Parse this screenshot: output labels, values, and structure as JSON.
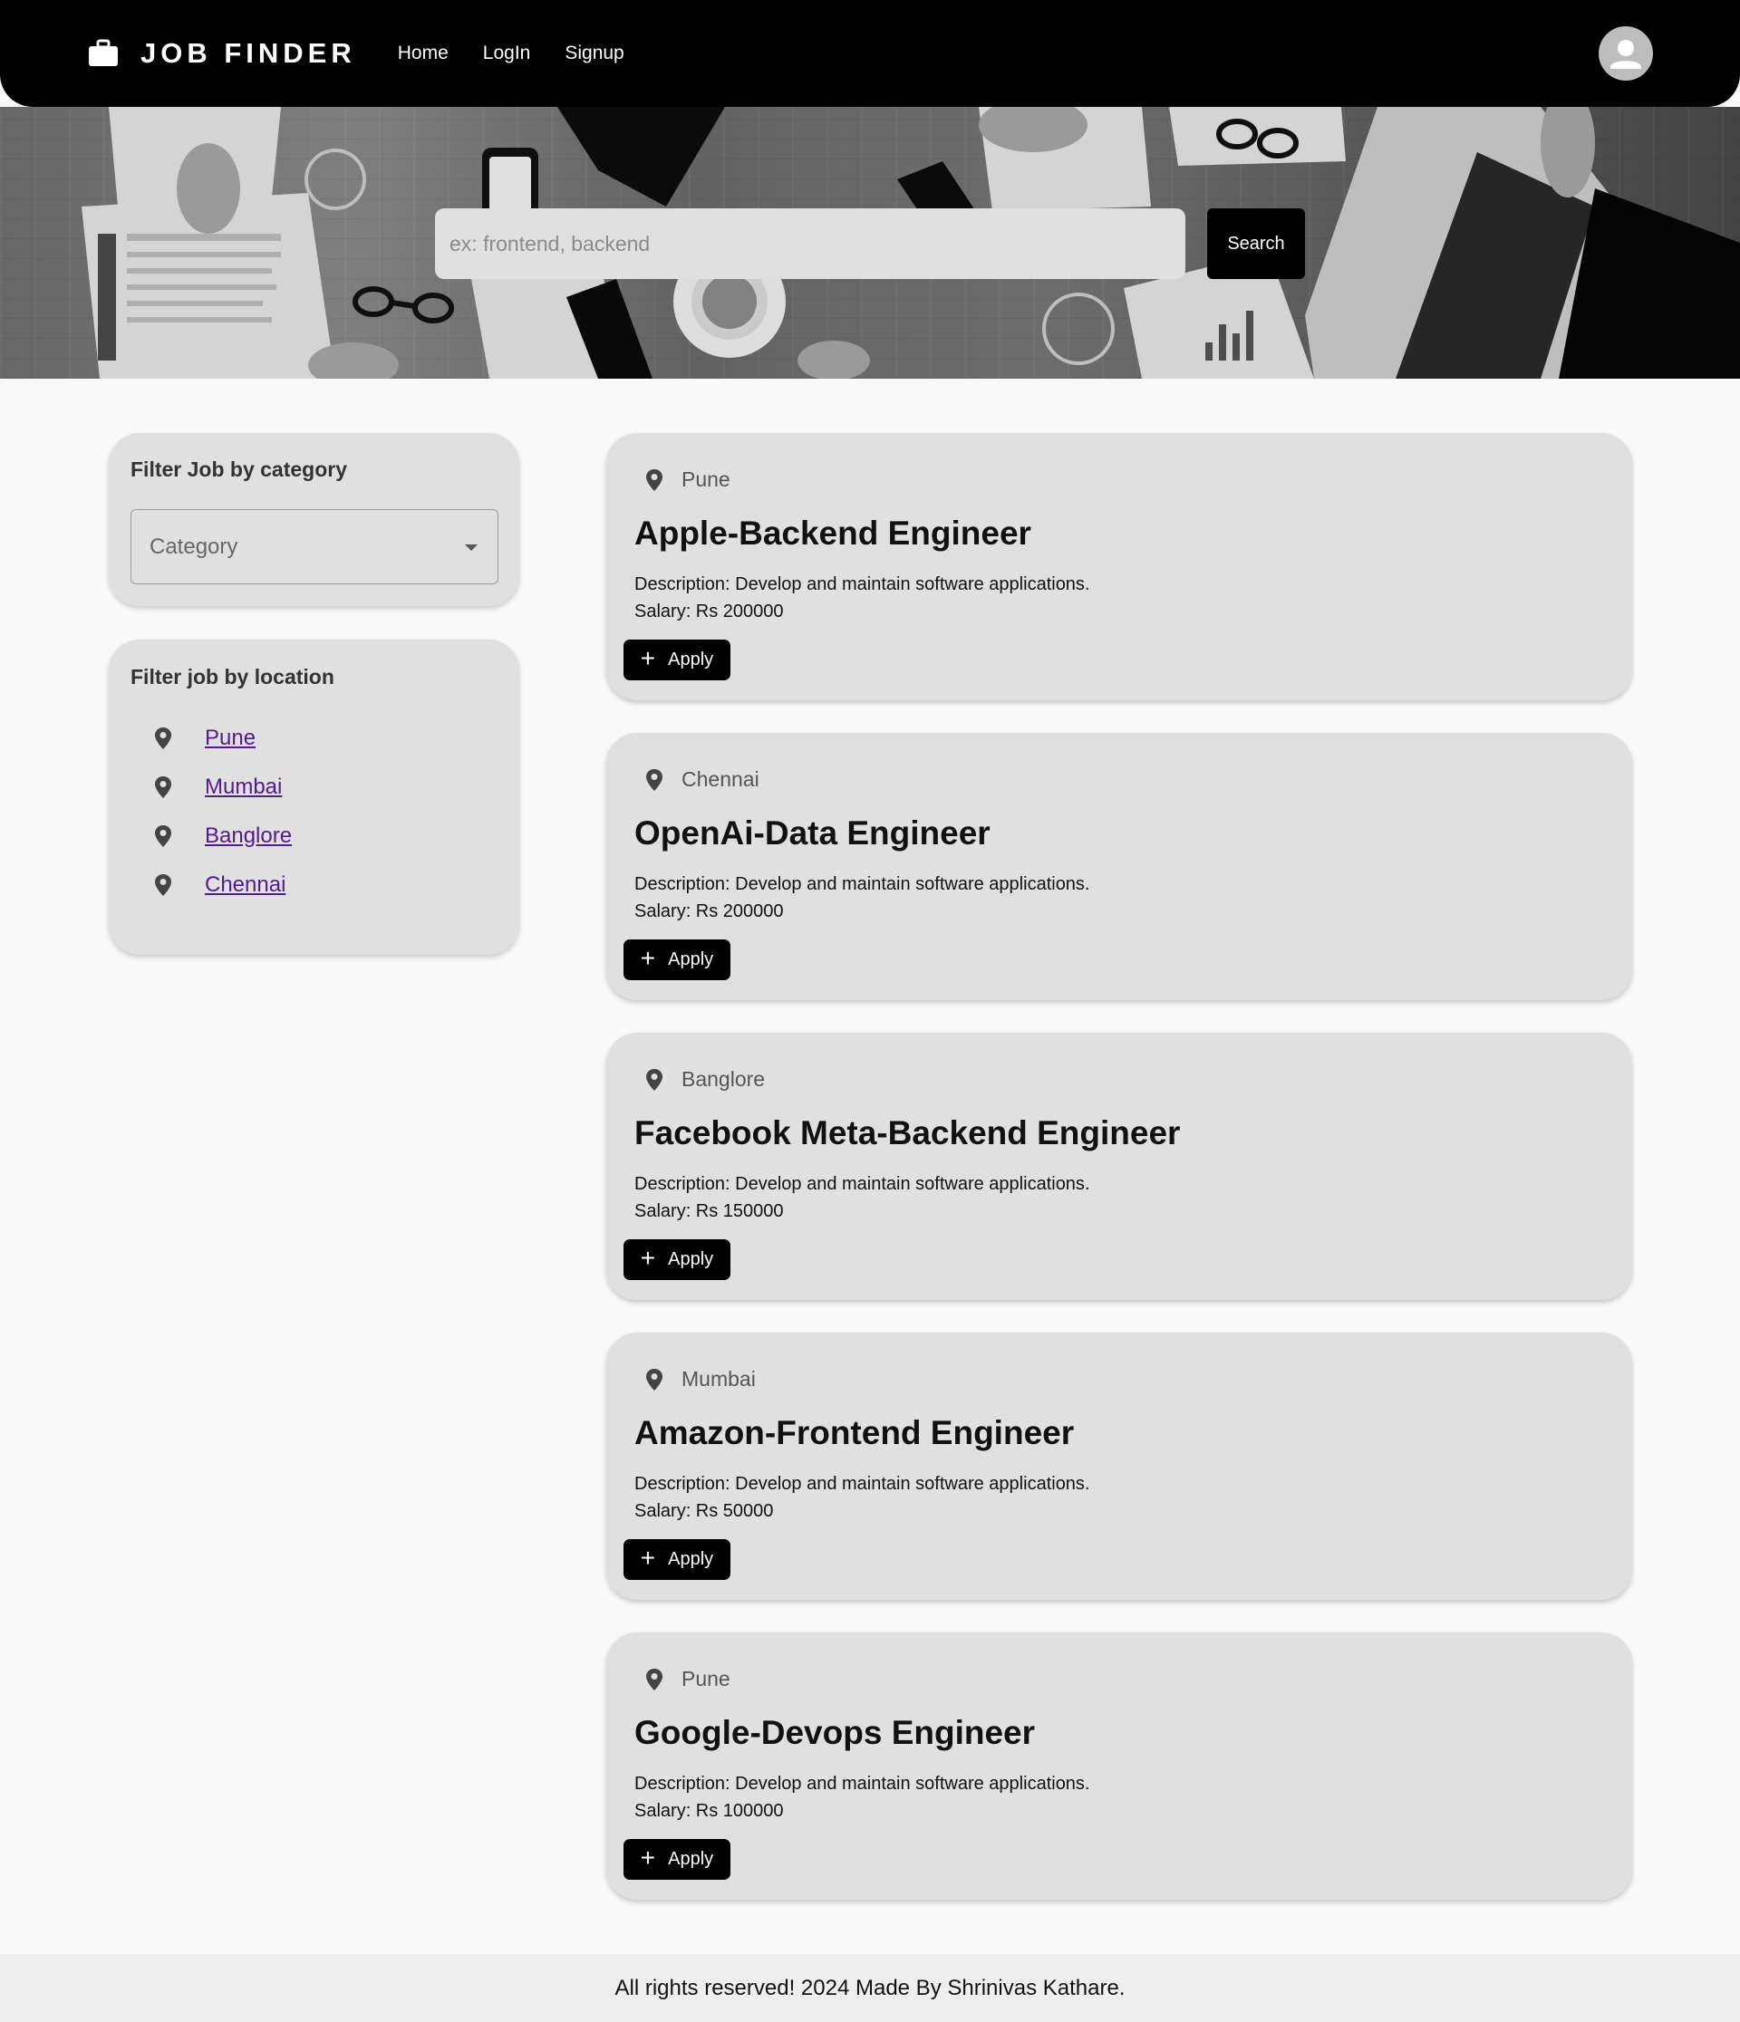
{
  "header": {
    "brand": "JOB FINDER",
    "nav": [
      "Home",
      "LogIn",
      "Signup"
    ]
  },
  "search": {
    "placeholder": "ex: frontend, backend",
    "button_label": "Search"
  },
  "sidebar": {
    "category_title": "Filter Job by category",
    "category_placeholder": "Category",
    "location_title": "Filter job by location",
    "locations": [
      "Pune",
      "Mumbai",
      "Banglore",
      "Chennai"
    ]
  },
  "jobs": [
    {
      "location": "Pune",
      "title": "Apple-Backend Engineer",
      "description": "Description: Develop and maintain software applications.",
      "salary": "Salary: Rs 200000",
      "apply_label": "Apply"
    },
    {
      "location": "Chennai",
      "title": "OpenAi-Data Engineer",
      "description": "Description: Develop and maintain software applications.",
      "salary": "Salary: Rs 200000",
      "apply_label": "Apply"
    },
    {
      "location": "Banglore",
      "title": "Facebook Meta-Backend Engineer",
      "description": "Description: Develop and maintain software applications.",
      "salary": "Salary: Rs 150000",
      "apply_label": "Apply"
    },
    {
      "location": "Mumbai",
      "title": "Amazon-Frontend Engineer",
      "description": "Description: Develop and maintain software applications.",
      "salary": "Salary: Rs 50000",
      "apply_label": "Apply"
    },
    {
      "location": "Pune",
      "title": "Google-Devops Engineer",
      "description": "Description: Develop and maintain software applications.",
      "salary": "Salary: Rs 100000",
      "apply_label": "Apply"
    }
  ],
  "footer": {
    "text": "All rights reserved! 2024 Made By Shrinivas Kathare."
  },
  "colors": {
    "navbar": "#000000",
    "card": "#e0e0e0",
    "button": "#000000",
    "link": "#551a8b"
  },
  "icons": {
    "brand": "briefcase-icon",
    "avatar": "user-icon",
    "location": "location-pin-icon",
    "apply": "plus-icon",
    "select": "chevron-down-icon"
  }
}
